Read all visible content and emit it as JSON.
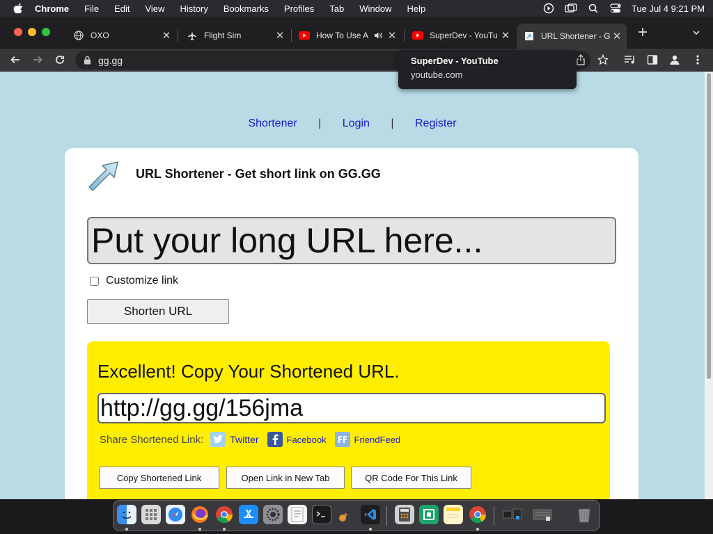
{
  "menubar": {
    "app_name": "Chrome",
    "items": [
      "File",
      "Edit",
      "View",
      "History",
      "Bookmarks",
      "Profiles",
      "Tab",
      "Window",
      "Help"
    ],
    "datetime": "Tue Jul 4  9:21 PM"
  },
  "tabs": [
    {
      "title": "OXO",
      "icon": "globe-icon"
    },
    {
      "title": "Flight Sim",
      "icon": "airplane-icon"
    },
    {
      "title": "How To Use A",
      "icon": "youtube-icon"
    },
    {
      "title": "SuperDev - YouTu",
      "icon": "youtube-icon"
    },
    {
      "title": "URL Shortener - G",
      "icon": "page-icon",
      "active": true
    }
  ],
  "toolbar": {
    "url": "gg.gg"
  },
  "tooltip": {
    "title": "SuperDev - YouTube",
    "domain": "youtube.com"
  },
  "page": {
    "nav": [
      "Shortener",
      "Login",
      "Register"
    ],
    "heading": "URL Shortener - Get short link on GG.GG",
    "url_placeholder": "Put your long URL here...",
    "customize_label": "Customize link",
    "shorten_button": "Shorten URL",
    "result": {
      "message": "Excellent! Copy Your Shortened URL.",
      "short_url": "http://gg.gg/156jma",
      "share_label": "Share Shortened Link:",
      "share_links": [
        "Twitter",
        "Facebook",
        "FriendFeed"
      ],
      "buttons": [
        "Copy Shortened Link",
        "Open Link in New Tab",
        "QR Code For This Link"
      ]
    }
  },
  "colors": {
    "page_bg": "#b9dbe6",
    "link": "#1a18c8",
    "result_bg": "#ffee00"
  },
  "dock": {
    "apps": [
      "finder-icon",
      "launchpad-icon",
      "safari-icon",
      "firefox-icon",
      "chrome-icon",
      "app-store-icon",
      "system-settings-icon",
      "textedit-icon",
      "terminal-icon",
      "garageband-icon",
      "vscode-icon",
      "calculator-icon",
      "sketch-icon",
      "notes-icon",
      "chrome-icon",
      "downloads-icon",
      "trash-icon"
    ]
  }
}
